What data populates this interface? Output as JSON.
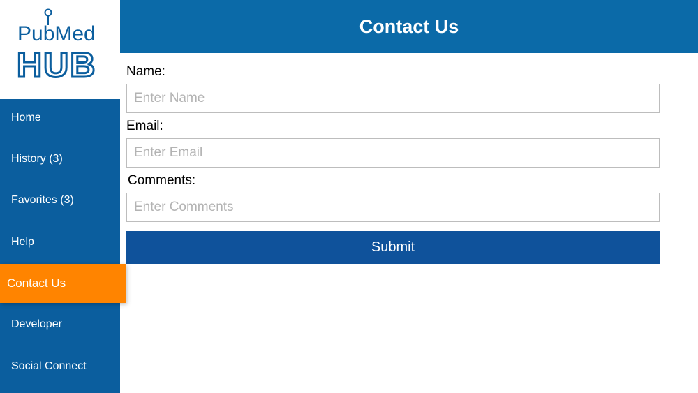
{
  "logo": {
    "line1": "PubMed",
    "line2": "HUB",
    "color": "#0b5e9e"
  },
  "sidebar": {
    "items": [
      {
        "label": "Home"
      },
      {
        "label": "History (3)"
      },
      {
        "label": "Favorites (3)"
      },
      {
        "label": "Help"
      },
      {
        "label": "Contact Us",
        "active": true
      },
      {
        "label": "Developer"
      },
      {
        "label": "Social Connect"
      }
    ]
  },
  "header": {
    "title": "Contact Us"
  },
  "form": {
    "name": {
      "label": "Name:",
      "placeholder": "Enter Name",
      "value": ""
    },
    "email": {
      "label": "Email:",
      "placeholder": "Enter Email",
      "value": ""
    },
    "comments": {
      "label": "Comments:",
      "placeholder": "Enter Comments",
      "value": ""
    },
    "submit_label": "Submit"
  },
  "colors": {
    "sidebar_bg": "#0b5e9e",
    "header_bg": "#0b6aa8",
    "active_item": "#ff8400",
    "submit_bg": "#0f529b"
  }
}
